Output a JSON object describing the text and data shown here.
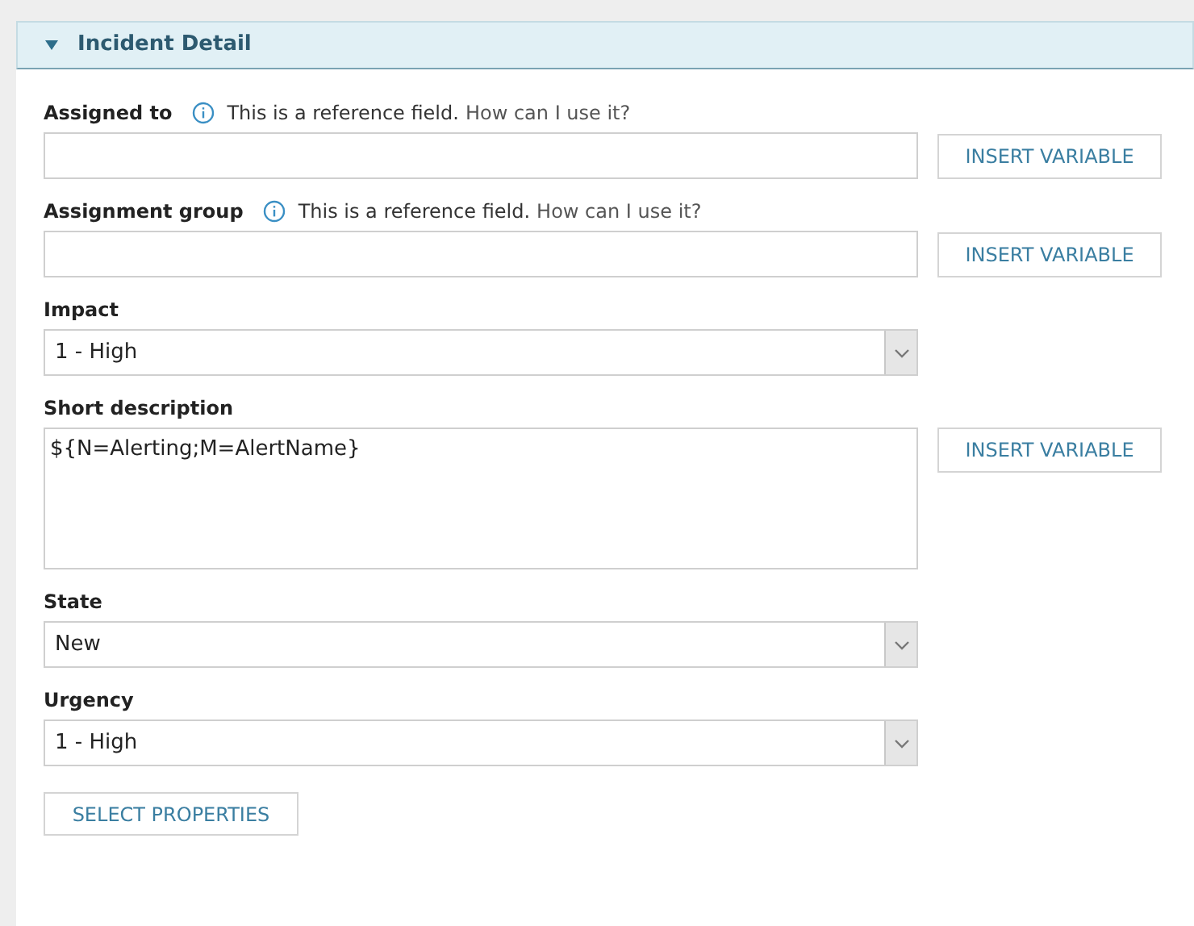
{
  "section": {
    "title": "Incident Detail",
    "expanded": true
  },
  "fields": [
    {
      "kind": "reference",
      "label": "Assigned to",
      "hint": "This is a reference field.",
      "hint_link": "How can I use it?",
      "button": "INSERT VARIABLE"
    },
    {
      "kind": "reference",
      "label": "Assignment group",
      "hint": "This is a reference field.",
      "hint_link": "How can I use it?",
      "button": "INSERT VARIABLE"
    },
    {
      "kind": "select",
      "label": "Impact",
      "value": "1 - High"
    },
    {
      "kind": "textarea",
      "label": "Short description",
      "value": "${N=Alerting;M=AlertName}",
      "button": "INSERT VARIABLE"
    },
    {
      "kind": "select",
      "label": "State",
      "value": "New"
    },
    {
      "kind": "select",
      "label": "Urgency",
      "value": "1 - High"
    }
  ],
  "footer_button": "SELECT PROPERTIES"
}
